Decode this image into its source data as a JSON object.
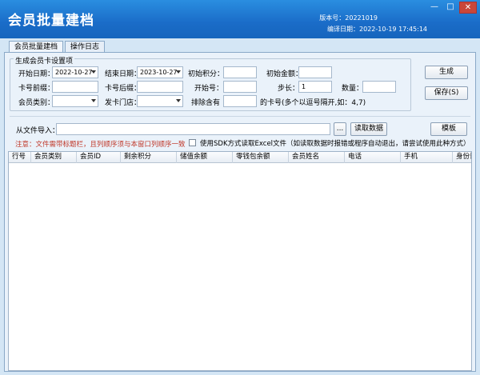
{
  "window": {
    "title": "会员批量建档",
    "version": "版本号：20221019",
    "build": "编译日期：2022-10-19 17:45:14",
    "controls": {
      "minimize": "—",
      "maximize": "□",
      "close": "✕"
    }
  },
  "tabs": [
    {
      "label": "会员批量建档"
    },
    {
      "label": "操作日志"
    }
  ],
  "group": {
    "legend": "生成会员卡设置项",
    "start_date": {
      "label": "开始日期：",
      "value": "2022-10-27"
    },
    "end_date": {
      "label": "结束日期：",
      "value": "2023-10-27"
    },
    "init_points": {
      "label": "初始积分：",
      "value": ""
    },
    "init_amount": {
      "label": "初始金额：",
      "value": ""
    },
    "card_prefix": {
      "label": "卡号前缀：",
      "value": ""
    },
    "card_suffix": {
      "label": "卡号后缀：",
      "value": ""
    },
    "start_no": {
      "label": "开始号：",
      "value": ""
    },
    "step": {
      "label": "步长：",
      "value": "1"
    },
    "quantity": {
      "label": "数量：",
      "value": ""
    },
    "member_type": {
      "label": "会员类别：",
      "value": ""
    },
    "issue_store": {
      "label": "发卡门店：",
      "value": ""
    },
    "exclude": {
      "label": "排除含有",
      "value": "",
      "suffix": "的卡号(多个以逗号隔开,如：4,7)"
    }
  },
  "buttons": {
    "generate": "生成",
    "save": "保存(S)",
    "browse": "...",
    "read": "读取数据",
    "template": "模板"
  },
  "import": {
    "label": "从文件导入：",
    "value": ""
  },
  "note": "注意：文件需带标题栏，且列顺序须与本窗口列顺序一致",
  "checkbox_label": "使用SDK方式读取Excel文件（如读取数据时报错或程序自动退出，请尝试使用此种方式）",
  "table": {
    "columns": [
      "行号",
      "会员类别",
      "会员ID",
      "剩余积分",
      "储值余额",
      "零钱包余额",
      "会员姓名",
      "电话",
      "手机",
      "身份证"
    ]
  },
  "colors": {
    "titlebar": "#1a6cc8",
    "panel": "#eaf2fa",
    "note": "#c0392b"
  }
}
